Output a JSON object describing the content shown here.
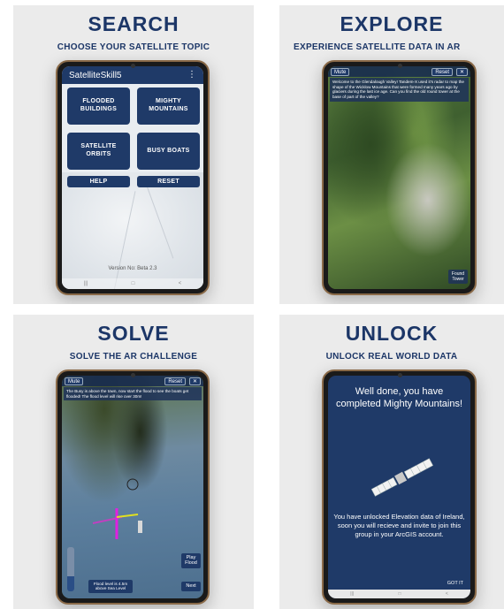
{
  "panels": {
    "search": {
      "title": "SEARCH",
      "subtitle": "CHOOSE YOUR SATELLITE TOPIC",
      "app_title": "SatelliteSkill5",
      "menu_glyph": "⋮",
      "topics": [
        {
          "label": "FLOODED\nBUILDINGS"
        },
        {
          "label": "MIGHTY\nMOUNTAINS"
        },
        {
          "label": "SATELLITE\nORBITS"
        },
        {
          "label": "BUSY BOATS"
        }
      ],
      "help_label": "HELP",
      "reset_label": "RESET",
      "version": "Version No: Beta 2.3",
      "nav": {
        "recent": "|||",
        "home": "□",
        "back": "<"
      }
    },
    "explore": {
      "title": "EXPLORE",
      "subtitle": "EXPERIENCE SATELLITE DATA IN AR",
      "mute_label": "Mute",
      "reset_label": "Reset",
      "close_glyph": "✕",
      "message": "Welcome to the Glendalough Valley! Tandem-X used it's radar to map the shape of the Wicklow Mountains that were formed many years ago by glaciers during the last ice age. Can you find the old round tower at the base of part of the valley?",
      "found_label": "Found Tower"
    },
    "solve": {
      "title": "SOLVE",
      "subtitle": "SOLVE THE AR CHALLENGE",
      "mute_label": "Mute",
      "reset_label": "Reset",
      "close_glyph": "✕",
      "message": "The Busy is above the town, now start the flood to see the boats get flooded! The flood level will rise over 30m!",
      "play_label": "Play Flood",
      "next_label": "Next",
      "flood_label": "Flood level is 4.5m above Sea Level",
      "flood_level": 0.35
    },
    "unlock": {
      "title": "UNLOCK",
      "subtitle": "UNLOCK REAL WORLD DATA",
      "well_done": "Well done, you have completed Mighty Mountains!",
      "message": "You have unlocked Elevation data of Ireland, soon you will recieve and invite to join this group in your ArcGIS account.",
      "got_it": "GOT IT",
      "nav": {
        "recent": "|||",
        "home": "□",
        "back": "<"
      }
    }
  },
  "colors": {
    "navy": "#1f3a68",
    "title": "#1c3667",
    "panel_bg": "#ebebeb"
  }
}
